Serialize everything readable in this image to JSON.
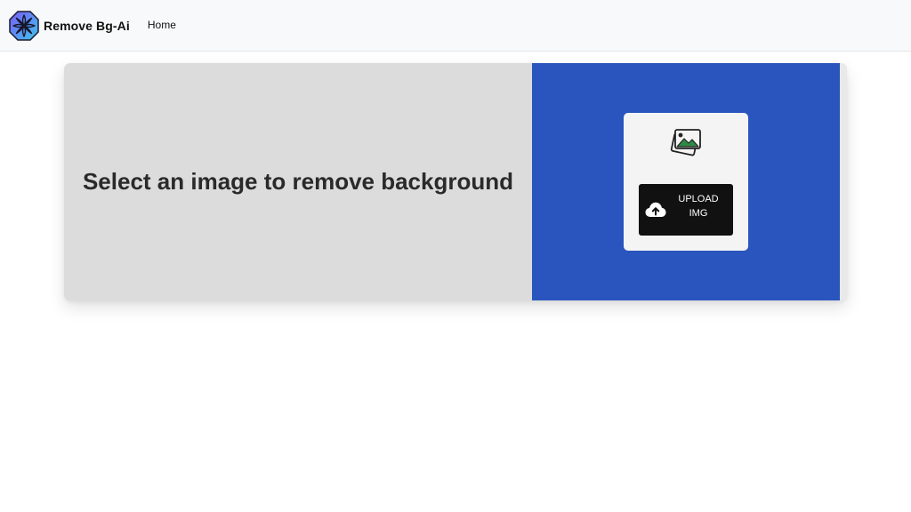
{
  "navbar": {
    "brand_name": "Remove Bg-Ai",
    "links": [
      {
        "label": "Home"
      }
    ]
  },
  "hero": {
    "headline": "Select an image to remove background",
    "upload": {
      "button_label": "UPLOAD\nIMG",
      "icon": "cloud-upload-icon",
      "preview_icon": "images-icon"
    }
  },
  "colors": {
    "navbar_bg": "#f8f9fa",
    "card_left_bg": "#dddcdc",
    "card_right_bg": "#2a55be",
    "upload_box_bg": "#f4f4f4",
    "button_bg": "#111111"
  }
}
